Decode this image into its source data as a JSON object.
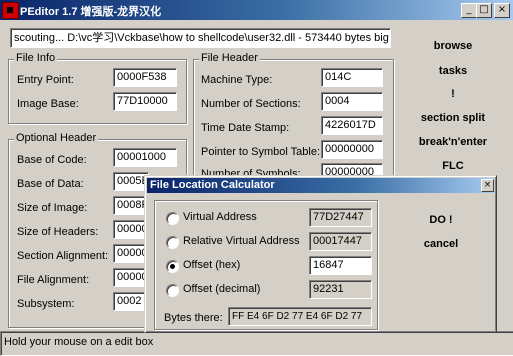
{
  "window": {
    "title": "PEditor 1.7 增强版-龙界汉化"
  },
  "path_bar": {
    "text": "scouting... D:\\vc学习\\Vckbase\\how to shellcode\\user32.dll - 573440 bytes big"
  },
  "file_info": {
    "title": "File Info",
    "entry_point_label": "Entry Point:",
    "entry_point": "0000F538",
    "image_base_label": "Image Base:",
    "image_base": "77D10000"
  },
  "optional_header": {
    "title": "Optional Header",
    "base_code_label": "Base of Code:",
    "base_code": "00001000",
    "base_data_label": "Base of Data:",
    "base_data": "0005E",
    "size_image_label": "Size of Image:",
    "size_image": "0008F",
    "size_headers_label": "Size of Headers:",
    "size_headers": "00000",
    "section_align_label": "Section Alignment:",
    "section_align": "00000",
    "file_align_label": "File Alignment:",
    "file_align": "00000",
    "subsystem_label": "Subsystem:",
    "subsystem": "0002"
  },
  "file_header": {
    "title": "File Header",
    "machine_label": "Machine Type:",
    "machine": "014C",
    "sections_label": "Number of Sections:",
    "sections": "0004",
    "timestamp_label": "Time Date Stamp:",
    "timestamp": "4226017D",
    "symtab_label": "Pointer to Symbol Table:",
    "symtab": "00000000",
    "numsym_label": "Number of Symbols:",
    "numsym": "00000000"
  },
  "right_buttons": {
    "browse": "browse",
    "tasks": "tasks",
    "bang": "!",
    "section_split": "section split",
    "break_enter": "break'n'enter",
    "flc": "FLC"
  },
  "status_bar": {
    "text": "Hold your mouse on a edit box"
  },
  "dialog": {
    "title": "File Location Calculator",
    "va_label": "Virtual Address",
    "va": "77D27447",
    "rva_label": "Relative Virtual Address",
    "rva": "00017447",
    "offset_label": "Offset (hex)",
    "offset": "16847",
    "offset_dec_label": "Offset (decimal)",
    "offset_dec": "92231",
    "bytes_label": "Bytes there:",
    "bytes": "FF E4 6F D2 77 E4 6F D2 77",
    "do_button": "DO !",
    "cancel_button": "cancel",
    "selected": "offset_hex"
  }
}
